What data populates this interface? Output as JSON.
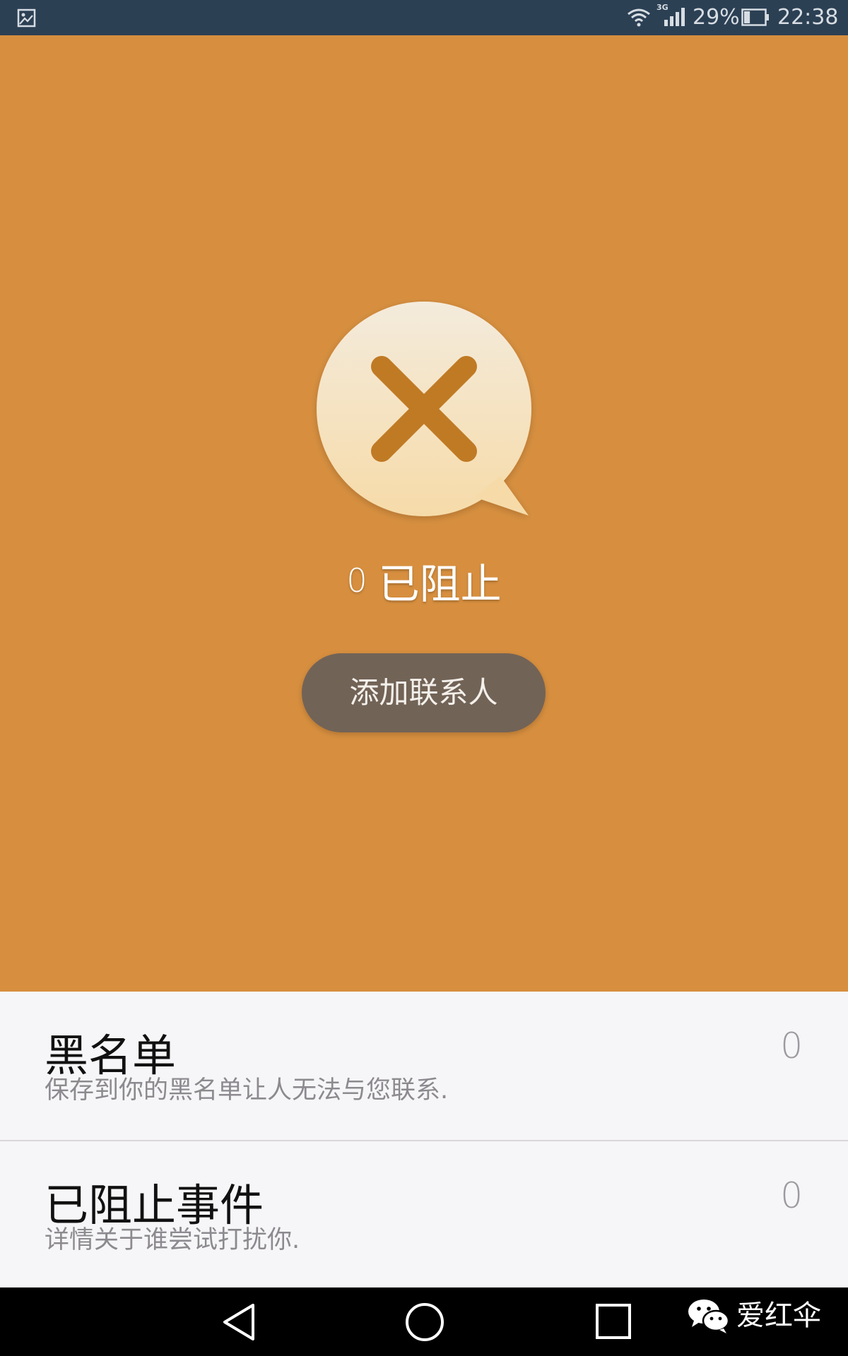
{
  "status_bar": {
    "network_type": "3G",
    "battery_percent": "29%",
    "battery_level": 0.29,
    "time": "22:38"
  },
  "hero": {
    "icon": "x-speech-bubble-icon",
    "blocked_count": "0",
    "blocked_label": "已阻止",
    "add_contact_label": "添加联系人",
    "background_color": "#d78f3f"
  },
  "list": {
    "items": [
      {
        "title": "黑名单",
        "subtitle": "保存到你的黑名单让人无法与您联系.",
        "count": "0"
      },
      {
        "title": "已阻止事件",
        "subtitle": "详情关于谁尝试打扰你.",
        "count": "0"
      }
    ]
  },
  "nav_bar": {
    "watermark_text": "爱红伞"
  }
}
